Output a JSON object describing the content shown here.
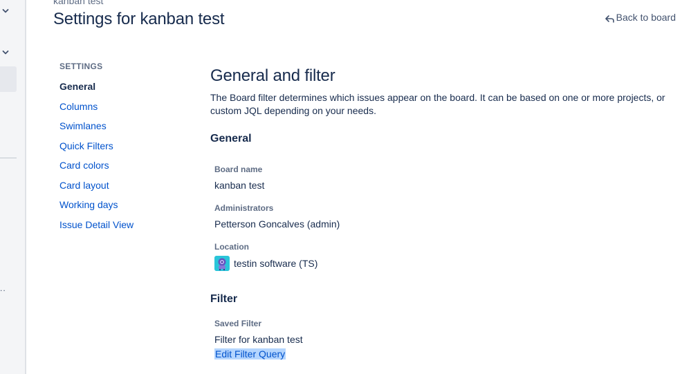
{
  "header": {
    "breadcrumb": "kanban test",
    "title": "Settings for kanban test",
    "back_link": "Back to board"
  },
  "sidebar": {
    "heading": "SETTINGS",
    "items": [
      {
        "label": "General",
        "active": true
      },
      {
        "label": "Columns"
      },
      {
        "label": "Swimlanes"
      },
      {
        "label": "Quick Filters"
      },
      {
        "label": "Card colors"
      },
      {
        "label": "Card layout"
      },
      {
        "label": "Working days"
      },
      {
        "label": "Issue Detail View"
      }
    ]
  },
  "main": {
    "title": "General and filter",
    "intro": "The Board filter determines which issues appear on the board. It can be based on one or more projects, or custom JQL depending on your needs.",
    "general": {
      "heading": "General",
      "board_name_label": "Board name",
      "board_name": "kanban test",
      "administrators_label": "Administrators",
      "administrators": "Petterson Goncalves (admin)",
      "location_label": "Location",
      "location": "testin software (TS)"
    },
    "filter": {
      "heading": "Filter",
      "saved_filter_label": "Saved Filter",
      "saved_filter": "Filter for kanban test",
      "edit_query": "Edit Filter Query"
    }
  },
  "rail": {
    "more": ".."
  },
  "colors": {
    "link": "#0052cc",
    "text": "#172b4d",
    "subtle": "#5e6c84",
    "selection": "#b4d5fe",
    "avatar": "#2ac5d9"
  },
  "icons": [
    "chevron-down-icon",
    "chevron-down-icon",
    "back-arrow-icon",
    "project-avatar-icon"
  ]
}
